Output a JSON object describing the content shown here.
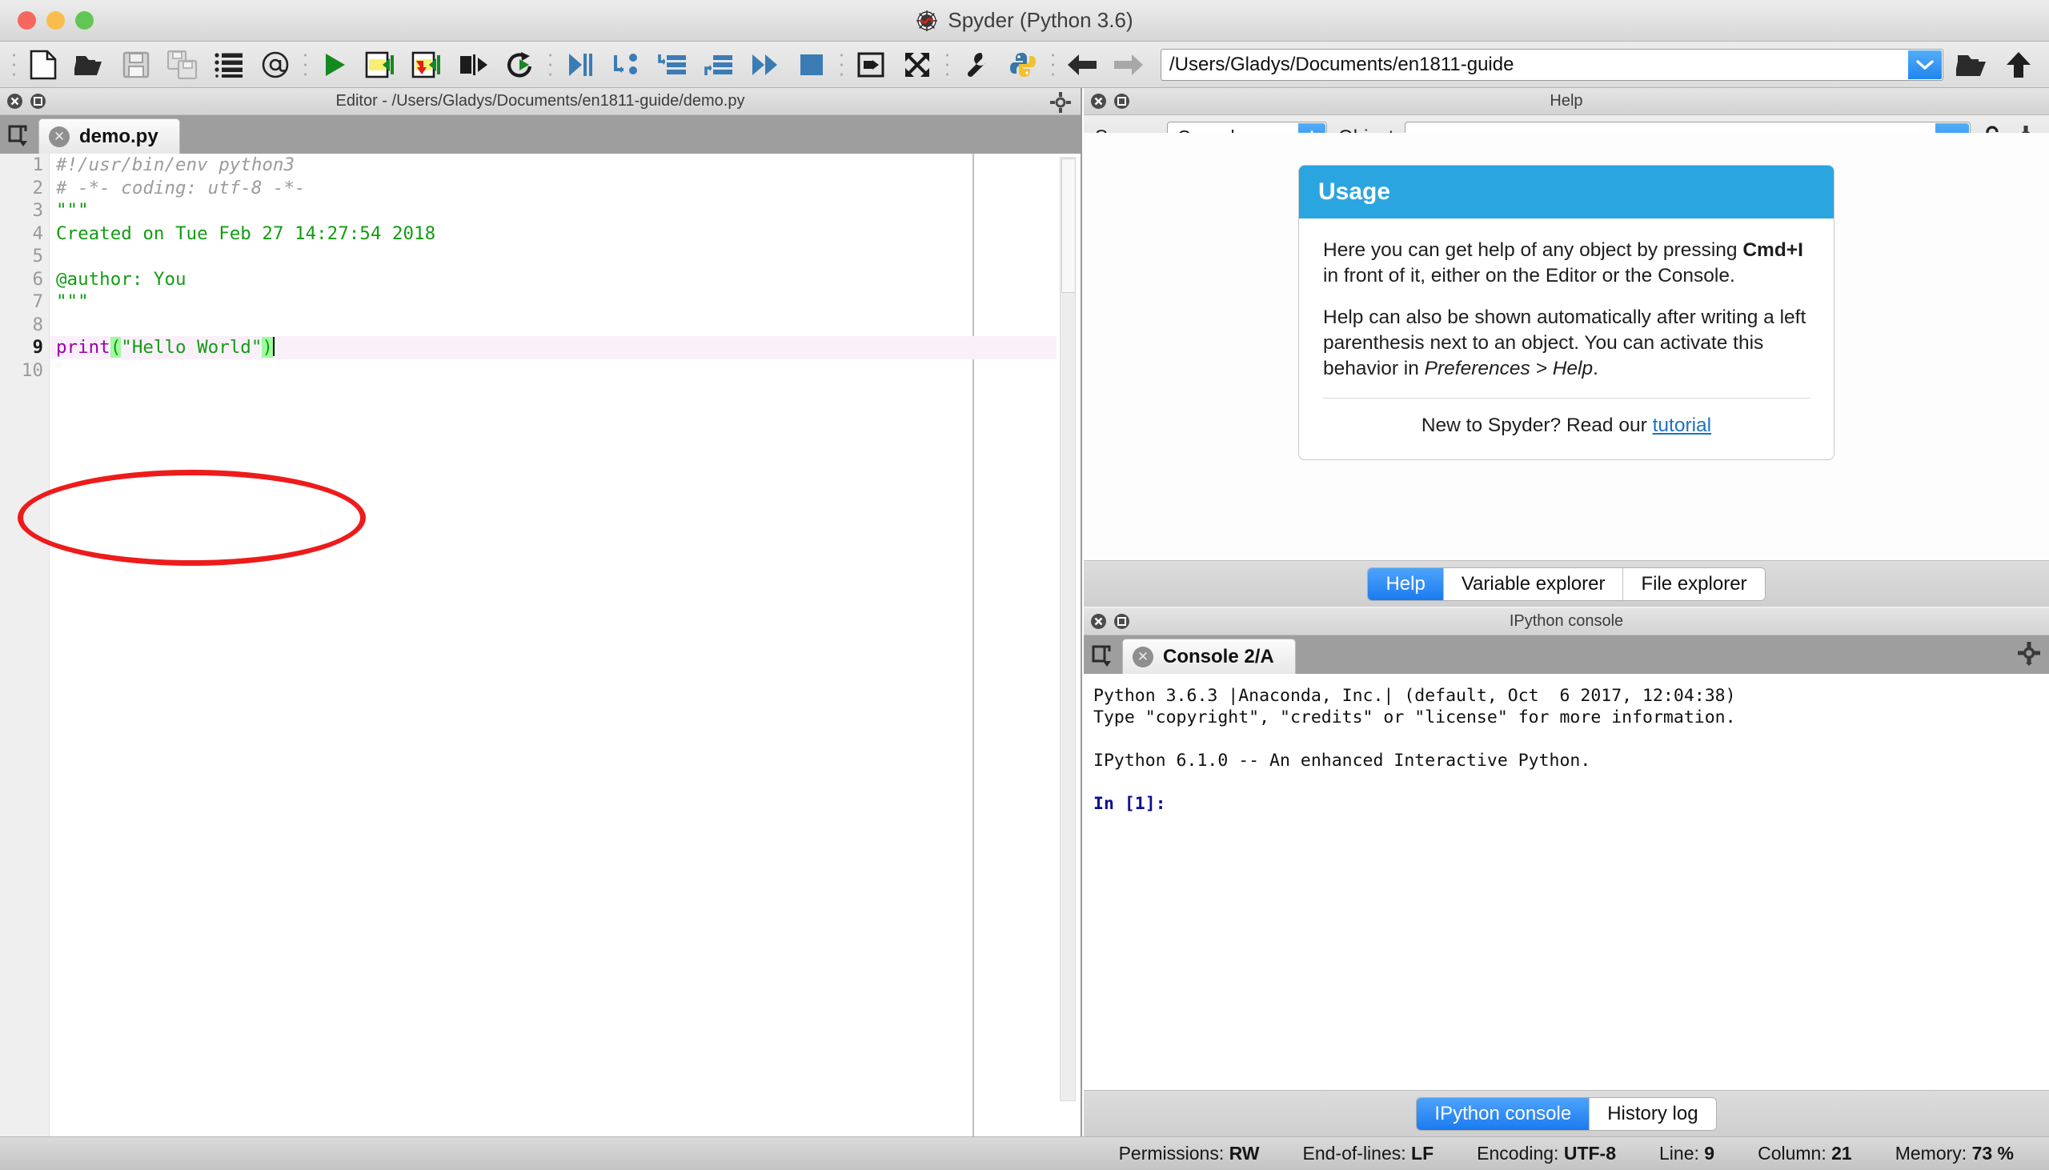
{
  "window": {
    "title": "Spyder (Python 3.6)",
    "app_icon": "spyder-web-icon"
  },
  "toolbar": {
    "buttons": [
      {
        "name": "new-file-icon",
        "tooltip": "New file"
      },
      {
        "name": "open-file-icon",
        "tooltip": "Open file"
      },
      {
        "name": "save-file-icon",
        "tooltip": "Save file"
      },
      {
        "name": "save-all-icon",
        "tooltip": "Save all"
      },
      {
        "name": "file-switcher-icon",
        "tooltip": "File switcher"
      },
      {
        "name": "find-symbol-icon",
        "tooltip": "Symbol finder"
      },
      {
        "name": "run-file-icon",
        "tooltip": "Run file"
      },
      {
        "name": "run-cell-icon",
        "tooltip": "Run cell"
      },
      {
        "name": "run-cell-advance-icon",
        "tooltip": "Run cell and advance"
      },
      {
        "name": "run-selection-icon",
        "tooltip": "Run selection"
      },
      {
        "name": "rerun-file-icon",
        "tooltip": "Re-run last script"
      },
      {
        "name": "debug-file-icon",
        "tooltip": "Debug file"
      },
      {
        "name": "debug-step-over-icon",
        "tooltip": "Run current line"
      },
      {
        "name": "debug-step-into-icon",
        "tooltip": "Step into"
      },
      {
        "name": "debug-step-return-icon",
        "tooltip": "Step return"
      },
      {
        "name": "debug-continue-icon",
        "tooltip": "Continue"
      },
      {
        "name": "debug-stop-icon",
        "tooltip": "Stop debugging"
      },
      {
        "name": "maximize-pane-icon",
        "tooltip": "Maximize current pane"
      },
      {
        "name": "fullscreen-icon",
        "tooltip": "Fullscreen mode"
      },
      {
        "name": "preferences-icon",
        "tooltip": "Preferences"
      },
      {
        "name": "pythonpath-icon",
        "tooltip": "PYTHONPATH manager"
      },
      {
        "name": "back-icon",
        "tooltip": "Previous directory"
      },
      {
        "name": "forward-icon",
        "tooltip": "Next directory"
      }
    ],
    "path_value": "/Users/Gladys/Documents/en1811-guide",
    "browse_icon": "open-folder-icon",
    "parent_icon": "up-arrow-icon"
  },
  "editor": {
    "pane_title": "Editor - /Users/Gladys/Documents/en1811-guide/demo.py",
    "browse_tabs_icon": "browse-tabs-icon",
    "options_icon": "gear-icon",
    "close_icon": "close-pane-icon",
    "undock_icon": "undock-pane-icon",
    "tab": {
      "label": "demo.py",
      "close": "✕"
    },
    "lines": [
      {
        "no": "1",
        "current": false,
        "tokens": [
          {
            "t": "#!/usr/bin/env python3",
            "c": "tok-comment"
          }
        ]
      },
      {
        "no": "2",
        "current": false,
        "tokens": [
          {
            "t": "# -*- coding: utf-8 -*-",
            "c": "tok-comment"
          }
        ]
      },
      {
        "no": "3",
        "current": false,
        "tokens": [
          {
            "t": "\"\"\"",
            "c": "tok-string"
          }
        ]
      },
      {
        "no": "4",
        "current": false,
        "tokens": [
          {
            "t": "Created on Tue Feb 27 14:27:54 2018",
            "c": "tok-string"
          }
        ]
      },
      {
        "no": "5",
        "current": false,
        "tokens": [
          {
            "t": "",
            "c": "tok-string"
          }
        ]
      },
      {
        "no": "6",
        "current": false,
        "tokens": [
          {
            "t": "@author: You",
            "c": "tok-string"
          }
        ]
      },
      {
        "no": "7",
        "current": false,
        "tokens": [
          {
            "t": "\"\"\"",
            "c": "tok-string"
          }
        ]
      },
      {
        "no": "8",
        "current": false,
        "tokens": [
          {
            "t": "",
            "c": ""
          }
        ]
      },
      {
        "no": "9",
        "current": true,
        "tokens": [
          {
            "t": "print",
            "c": "tok-kw"
          },
          {
            "t": "(",
            "c": "tok-paren"
          },
          {
            "t": "\"Hello World\"",
            "c": "tok-string"
          },
          {
            "t": ")",
            "c": "tok-paren"
          },
          {
            "t": "",
            "c": "caret"
          }
        ]
      },
      {
        "no": "10",
        "current": false,
        "tokens": [
          {
            "t": "",
            "c": ""
          }
        ]
      }
    ],
    "annotation": {
      "shape": "red-ellipse",
      "color": "#ee1b1b"
    }
  },
  "help": {
    "pane_title": "Help",
    "close_icon": "close-pane-icon",
    "undock_icon": "undock-pane-icon",
    "source_label": "Source",
    "source_value": "Console",
    "object_label": "Object",
    "object_value": "",
    "lock_icon": "unlocked-padlock-icon",
    "options_icon": "gear-icon",
    "card": {
      "heading": "Usage",
      "heading_bg": "#2ba5e0",
      "paragraph1_a": "Here you can get help of any object by pressing ",
      "paragraph1_b": "Cmd+I",
      "paragraph1_c": " in front of it, either on the Editor or the Console.",
      "paragraph2_a": "Help can also be shown automatically after writing a left parenthesis next to an object. You can activate this behavior in ",
      "paragraph2_b": "Preferences > Help",
      "paragraph2_c": ".",
      "footer_text": "New to Spyder? Read our ",
      "footer_link": "tutorial"
    },
    "tabs": [
      {
        "label": "Help",
        "active": true
      },
      {
        "label": "Variable explorer",
        "active": false
      },
      {
        "label": "File explorer",
        "active": false
      }
    ]
  },
  "console": {
    "pane_title": "IPython console",
    "close_icon": "close-pane-icon",
    "undock_icon": "undock-pane-icon",
    "browse_tabs_icon": "browse-tabs-icon",
    "options_icon": "gear-icon",
    "interrupt_icon": "interrupt-kernel-icon",
    "tab": {
      "label": "Console 2/A",
      "close": "✕"
    },
    "lines": [
      {
        "text": "Python 3.6.3 |Anaconda, Inc.| (default, Oct  6 2017, 12:04:38)",
        "cls": ""
      },
      {
        "text": "Type \"copyright\", \"credits\" or \"license\" for more information.",
        "cls": ""
      },
      {
        "text": "",
        "cls": ""
      },
      {
        "text": "IPython 6.1.0 -- An enhanced Interactive Python.",
        "cls": ""
      },
      {
        "text": "",
        "cls": ""
      },
      {
        "text": "In [1]: ",
        "cls": "cons-prompt"
      }
    ],
    "tabs": [
      {
        "label": "IPython console",
        "active": true
      },
      {
        "label": "History log",
        "active": false
      }
    ]
  },
  "statusbar": {
    "items": [
      {
        "label": "Permissions:",
        "value": "RW"
      },
      {
        "label": "End-of-lines:",
        "value": "LF"
      },
      {
        "label": "Encoding:",
        "value": "UTF-8"
      },
      {
        "label": "Line:",
        "value": "9"
      },
      {
        "label": "Column:",
        "value": "21"
      },
      {
        "label": "Memory:",
        "value": "73 %"
      }
    ]
  }
}
